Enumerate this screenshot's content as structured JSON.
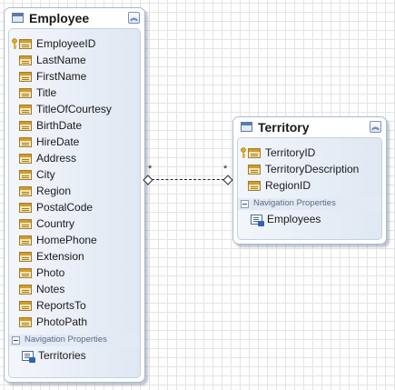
{
  "employee": {
    "title": "Employee",
    "collapse_icon": "double-chevron-up-icon",
    "properties": [
      {
        "label": "EmployeeID",
        "key": true
      },
      {
        "label": "LastName"
      },
      {
        "label": "FirstName"
      },
      {
        "label": "Title"
      },
      {
        "label": "TitleOfCourtesy"
      },
      {
        "label": "BirthDate"
      },
      {
        "label": "HireDate"
      },
      {
        "label": "Address"
      },
      {
        "label": "City"
      },
      {
        "label": "Region"
      },
      {
        "label": "PostalCode"
      },
      {
        "label": "Country"
      },
      {
        "label": "HomePhone"
      },
      {
        "label": "Extension"
      },
      {
        "label": "Photo"
      },
      {
        "label": "Notes"
      },
      {
        "label": "ReportsTo"
      },
      {
        "label": "PhotoPath"
      }
    ],
    "nav_section_label": "Navigation Properties",
    "nav_properties": [
      {
        "label": "Territories"
      }
    ]
  },
  "territory": {
    "title": "Territory",
    "collapse_icon": "double-chevron-up-icon",
    "properties": [
      {
        "label": "TerritoryID",
        "key": true
      },
      {
        "label": "TerritoryDescription"
      },
      {
        "label": "RegionID"
      }
    ],
    "nav_section_label": "Navigation Properties",
    "nav_properties": [
      {
        "label": "Employees"
      }
    ]
  },
  "association": {
    "left_multiplicity": "*",
    "right_multiplicity": "*"
  }
}
